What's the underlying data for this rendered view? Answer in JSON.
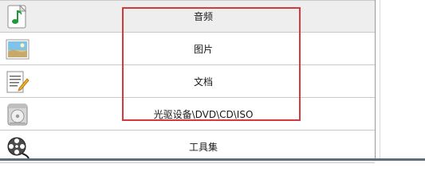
{
  "category_list": {
    "items": [
      {
        "label": "音频",
        "icon": "music-note-icon",
        "selected": true
      },
      {
        "label": "图片",
        "icon": "image-icon",
        "selected": false
      },
      {
        "label": "文档",
        "icon": "document-icon",
        "selected": false
      },
      {
        "label": "光驱设备\\DVD\\CD\\ISO",
        "icon": "optical-drive-icon",
        "selected": false
      },
      {
        "label": "工具集",
        "icon": "film-reel-icon",
        "selected": false
      }
    ]
  },
  "annotation": {
    "highlight_color": "#d6393b"
  }
}
